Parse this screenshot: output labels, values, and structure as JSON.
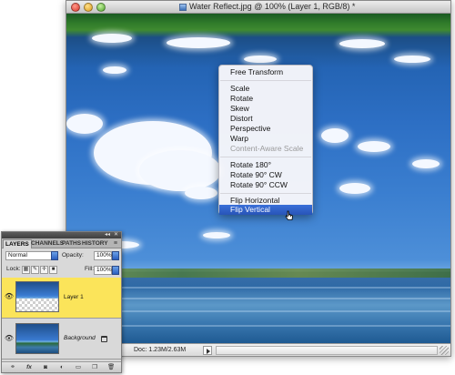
{
  "window": {
    "title": "Water Reflect.jpg @ 100% (Layer 1, RGB/8) *"
  },
  "context_menu": {
    "groups": [
      [
        {
          "label": "Free Transform",
          "state": "normal"
        }
      ],
      [
        {
          "label": "Scale",
          "state": "normal"
        },
        {
          "label": "Rotate",
          "state": "normal"
        },
        {
          "label": "Skew",
          "state": "normal"
        },
        {
          "label": "Distort",
          "state": "normal"
        },
        {
          "label": "Perspective",
          "state": "normal"
        },
        {
          "label": "Warp",
          "state": "normal"
        },
        {
          "label": "Content-Aware Scale",
          "state": "disabled"
        }
      ],
      [
        {
          "label": "Rotate 180°",
          "state": "normal"
        },
        {
          "label": "Rotate 90° CW",
          "state": "normal"
        },
        {
          "label": "Rotate 90° CCW",
          "state": "normal"
        }
      ],
      [
        {
          "label": "Flip Horizontal",
          "state": "normal"
        },
        {
          "label": "Flip Vertical",
          "state": "selected"
        }
      ]
    ]
  },
  "status_bar": {
    "doc_size": "Doc: 1.23M/2.63M"
  },
  "layers_panel": {
    "tabs": [
      "LAYERS",
      "CHANNELS",
      "PATHS",
      "HISTORY"
    ],
    "active_tab": "LAYERS",
    "blend_mode": "Normal",
    "opacity_label": "Opacity:",
    "opacity_value": "100%",
    "lock_label": "Lock:",
    "fill_label": "Fill:",
    "fill_value": "100%",
    "layers": [
      {
        "name": "Layer 1",
        "selected": true,
        "visible": true
      },
      {
        "name": "Background",
        "selected": false,
        "visible": true,
        "locked": true
      }
    ],
    "footer_fx": "fx",
    "colors": {
      "selected_row": "#fbe45a",
      "selection_highlight": "#2a5fc8"
    }
  }
}
